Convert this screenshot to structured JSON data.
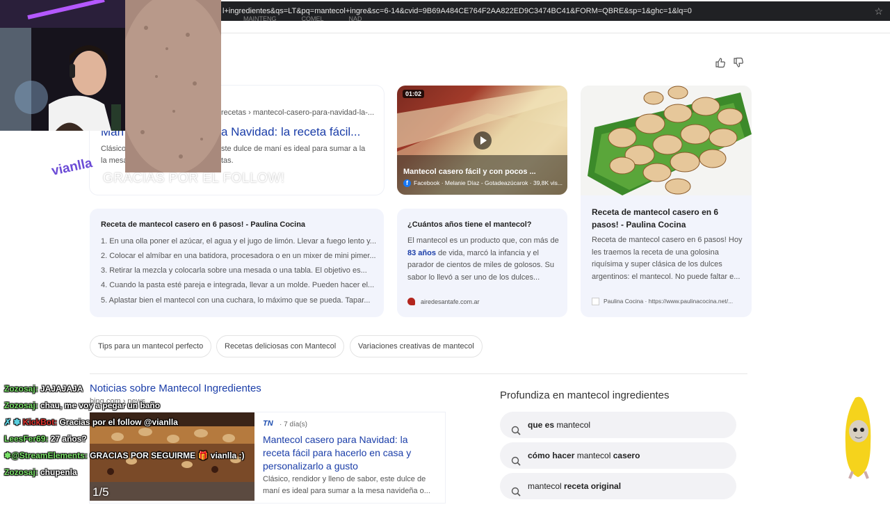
{
  "browser": {
    "url": "l+ingredientes&qs=LT&pq=mantecol+ingre&sc=6-14&cvid=9B69A484CE764F2AA822ED9C3474BC41&FORM=QBRE&sp=1&ghc=1&lq=0",
    "star_icon": "star-icon"
  },
  "result_main": {
    "breadcrumb": "recetas › mantecol-casero-para-navidad-la-...",
    "title_left": "Man",
    "title_right": "a Navidad: la receta fácil...",
    "desc1_left": "Clásico",
    "desc1_right": "ste dulce de maní es ideal para sumar a la",
    "desc2_left": "la mesa n",
    "desc2_right": "tas."
  },
  "video": {
    "duration": "01:02",
    "title": "Mantecol casero fácil y con pocos ...",
    "source": "Facebook · Melanie Díaz - Gotadeazúcarok · 39,8K vis..."
  },
  "paulina_card": {
    "title": "Receta de mantecol casero en 6 pasos! - Paulina Cocina",
    "desc": "Receta de mantecol casero en 6 pasos! Hoy les traemos la receta de una golosina riquísima y super clásica de los dulces argentinos: el mantecol. No puede faltar e...",
    "source": "Paulina Cocina · https://www.paulinacocina.net/..."
  },
  "steps_card": {
    "title": "Receta de mantecol casero en 6 pasos! - Paulina Cocina",
    "steps": [
      "1. En una olla poner el azúcar, el agua y el jugo de limón. Llevar a fuego lento y...",
      "2. Colocar el almíbar en una batidora, procesadora o en un mixer de mini pimer...",
      "3. Retirar la mezcla y colocarla sobre una mesada o una tabla. El objetivo es...",
      "4. Cuando la pasta esté pareja e integrada, llevar a un molde. Pueden hacer el...",
      "5. Aplastar bien el mantecol con una cuchara, lo máximo que se pueda. Tapar..."
    ]
  },
  "age_card": {
    "title": "¿Cuántos años tiene el mantecol?",
    "text_before": "El mantecol es un producto que, con más de ",
    "highlight": "83 años",
    "text_after": " de vida, marcó la infancia y el parador de cientos de miles de golosos. Su sabor lo llevó a ser uno de los dulces...",
    "source": "airedesantafe.com.ar"
  },
  "chips": [
    "Tips para un mantecol perfecto",
    "Recetas deliciosas con Mantecol",
    "Variaciones creativas de mantecol"
  ],
  "news": {
    "heading": "Noticias sobre Mantecol Ingredientes",
    "sub": "bing.com › news",
    "source_logo": "TN",
    "age": "· 7 día(s)",
    "title": "Mantecol casero para Navidad: la receta fácil para hacerlo en casa y personalizarlo a gusto",
    "desc": "Clásico, rendidor y lleno de sabor, este dulce de maní es ideal para sumar a la mesa navideña o...",
    "pager": "1/5"
  },
  "related": {
    "heading": "Profundiza en mantecol ingredientes",
    "items": [
      {
        "pre": "que es",
        "post": " mantecol",
        "post_bold": false
      },
      {
        "pre": "cómo hacer",
        "post": " mantecol ",
        "tail": "casero"
      },
      {
        "pre": "mantecol ",
        "post": "receta original",
        "post_bold": true
      }
    ]
  },
  "stream": {
    "logo": "vianlla",
    "follow_text": "GRACIAS POR EL FOLLOW!"
  },
  "chat": [
    {
      "user": "Zozosaj:",
      "msg": " JAJAJAJA",
      "color": "#7be36a"
    },
    {
      "user": "Zozosaj:",
      "msg": " chau, me voy a pegar un baño",
      "color": "#7be36a"
    },
    {
      "user": "KickBot:",
      "msg": " Gracias por el follow @vianlla",
      "color": "#e0332f",
      "icons": "✗ ✽"
    },
    {
      "user": "LeesFer69:",
      "msg": " 27 años?",
      "color": "#7be36a"
    },
    {
      "user": "@StreamElements:",
      "msg": " GRACIAS POR SEGUIRME 🎁 vianlla :)",
      "color": "#7be36a",
      "icons": "✽"
    },
    {
      "user": "Zozosaj:",
      "msg": " chupenla",
      "color": "#7be36a"
    }
  ]
}
